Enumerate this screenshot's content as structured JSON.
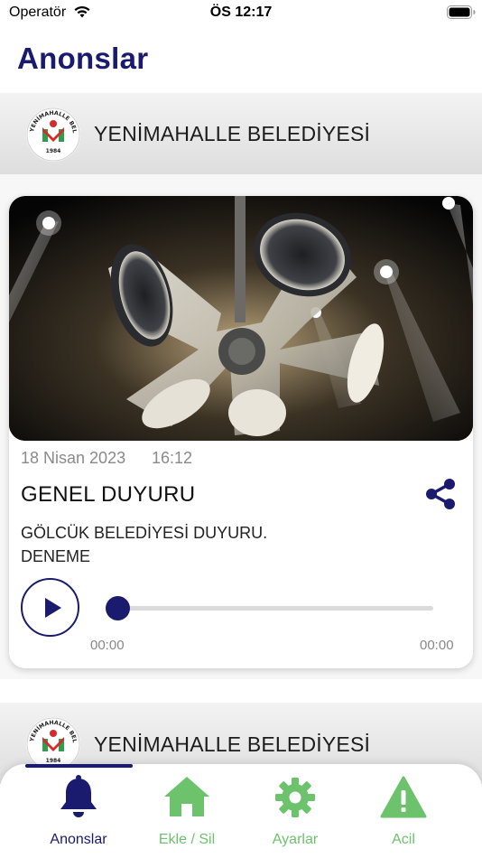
{
  "status_bar": {
    "carrier": "Operatör",
    "time": "ÖS 12:17"
  },
  "page": {
    "title": "Anonslar"
  },
  "feed": [
    {
      "organization": "YENİMAHALLE BELEDİYESİ",
      "logo_text": {
        "top": "YENİMAHALLE BELEDİYESİ",
        "year": "1984"
      },
      "date": "18 Nisan 2023",
      "time": "16:12",
      "title": "GENEL DUYURU",
      "body": "GÖLCÜK BELEDİYESİ DUYURU.\nDENEME",
      "audio": {
        "current": "00:00",
        "total": "00:00",
        "progress": 0
      }
    },
    {
      "organization": "YENİMAHALLE BELEDİYESİ",
      "logo_text": {
        "top": "YENİMAHALLE BELEDİYESİ",
        "year": "1984"
      }
    }
  ],
  "tab_bar": {
    "active_color": "#1a1a6e",
    "inactive_color": "#6cc36c",
    "tabs": [
      {
        "label": "Anonslar",
        "icon": "bell-icon",
        "active": true
      },
      {
        "label": "Ekle / Sil",
        "icon": "home-icon",
        "active": false
      },
      {
        "label": "Ayarlar",
        "icon": "gear-icon",
        "active": false
      },
      {
        "label": "Acil",
        "icon": "warning-icon",
        "active": false
      }
    ]
  }
}
